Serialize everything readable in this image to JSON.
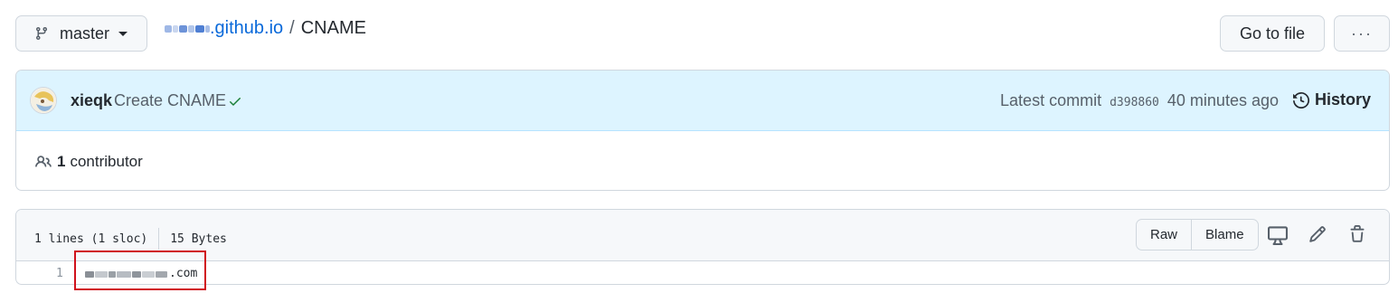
{
  "branch": {
    "name": "master",
    "icon": "git-branch-icon"
  },
  "breadcrumb": {
    "repo_suffix": ".github.io",
    "separator": "/",
    "file": "CNAME"
  },
  "actions": {
    "go_to_file": "Go to file",
    "more": "···"
  },
  "commit": {
    "author": "xieqk",
    "message": "Create CNAME",
    "status_icon": "check-icon",
    "latest_label": "Latest commit",
    "sha": "d398860",
    "time": "40 minutes ago",
    "history": "History"
  },
  "contributors": {
    "count": "1",
    "label": "contributor"
  },
  "file": {
    "lines": "1 lines (1 sloc)",
    "size": "15 Bytes",
    "raw": "Raw",
    "blame": "Blame",
    "tools": [
      "desktop-icon",
      "pencil-icon",
      "trash-icon"
    ]
  },
  "code": {
    "line_number": "1",
    "domain_suffix": ".com"
  },
  "colors": {
    "link": "#0969da",
    "commit_bg": "#ddf4ff",
    "success": "#1a7f37",
    "highlight": "#d0111c"
  }
}
